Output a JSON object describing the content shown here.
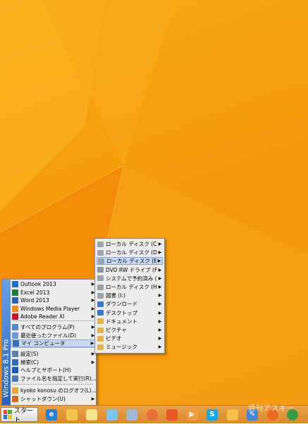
{
  "start_menu": {
    "banner": "Windows 8.1 Pro",
    "pinned": [
      {
        "label": "Outlook 2013",
        "icon": "outlook-icon",
        "color": "#1f6fc5",
        "has_arrow": true
      },
      {
        "label": "Excel 2013",
        "icon": "excel-icon",
        "color": "#1f7a3a",
        "has_arrow": true
      },
      {
        "label": "Word 2013",
        "icon": "word-icon",
        "color": "#2b5fb4",
        "has_arrow": true
      },
      {
        "label": "Windows Media Player",
        "icon": "media-player-icon",
        "color": "#f08a1c",
        "has_arrow": true
      },
      {
        "label": "Adobe Reader XI",
        "icon": "adobe-reader-icon",
        "color": "#c8102e",
        "has_arrow": true
      }
    ],
    "items": [
      {
        "label": "すべてのプログラム(P)",
        "icon": "programs-icon",
        "color": "#5a86c8",
        "has_arrow": true
      },
      {
        "label": "最近使ったファイル(D)",
        "icon": "recent-files-icon",
        "color": "#6a9bd6",
        "has_arrow": true
      },
      {
        "label": "マイ コンピュータ",
        "icon": "my-computer-icon",
        "color": "#3a6db0",
        "has_arrow": true,
        "selected": true
      }
    ],
    "settings": [
      {
        "label": "設定(S)",
        "icon": "settings-icon",
        "color": "#5d7fa8",
        "has_arrow": true
      },
      {
        "label": "検索(C)",
        "icon": "search-icon",
        "color": "#2f6bbd",
        "has_arrow": true
      },
      {
        "label": "ヘルプとサポート(H)",
        "icon": "help-icon",
        "color": "#1d58b8",
        "has_arrow": false
      },
      {
        "label": "ファイル名を指定して実行(R)...",
        "icon": "run-icon",
        "color": "#4a78b8",
        "has_arrow": false
      }
    ],
    "session": [
      {
        "label": "kyoko konosu のログオフ(L)...",
        "icon": "logoff-icon",
        "color": "#e8a73a",
        "has_arrow": false
      },
      {
        "label": "シャットダウン(U)",
        "icon": "shutdown-icon",
        "color": "#d66a1e",
        "has_arrow": true
      }
    ]
  },
  "sub_menu": {
    "items": [
      {
        "label": "ローカル ディスク (C:)",
        "icon": "drive-icon",
        "color": "#9aa4ae"
      },
      {
        "label": "ローカル ディスク (D:)",
        "icon": "drive-icon",
        "color": "#9aa4ae"
      },
      {
        "label": "ローカル ディスク (E:)",
        "icon": "drive-icon",
        "color": "#9aa4ae",
        "selected": true
      },
      {
        "label": "DVD RW ドライブ (F:)",
        "icon": "dvd-drive-icon",
        "color": "#8a96a2"
      },
      {
        "label": "システムで予約済み (G:)",
        "icon": "drive-icon",
        "color": "#9aa4ae"
      },
      {
        "label": "ローカル ディスク (H:)",
        "icon": "drive-icon",
        "color": "#9aa4ae"
      },
      {
        "label": "図書 (I:)",
        "icon": "drive-icon",
        "color": "#9aa4ae"
      },
      {
        "label": "ダウンロード",
        "icon": "downloads-folder-icon",
        "color": "#3b78c8"
      },
      {
        "label": "デスクトップ",
        "icon": "desktop-folder-icon",
        "color": "#3b78c8"
      },
      {
        "label": "ドキュメント",
        "icon": "documents-folder-icon",
        "color": "#e0b44a"
      },
      {
        "label": "ピクチャ",
        "icon": "pictures-folder-icon",
        "color": "#e0b44a"
      },
      {
        "label": "ビデオ",
        "icon": "videos-folder-icon",
        "color": "#e0b44a"
      },
      {
        "label": "ミュージック",
        "icon": "music-folder-icon",
        "color": "#e0b44a"
      }
    ]
  },
  "taskbar": {
    "start_label": "スタート",
    "apps": [
      {
        "name": "internet-explorer-icon",
        "glyph": "e",
        "color": "#2a7fd4"
      },
      {
        "name": "file-explorer-icon",
        "glyph": "",
        "color": "#f1c44e"
      },
      {
        "name": "sticky-notes-icon",
        "glyph": "",
        "color": "#f5e28a"
      },
      {
        "name": "notepad-icon",
        "glyph": "",
        "color": "#7fc4e8"
      },
      {
        "name": "calculator-icon",
        "glyph": "",
        "color": "#9fb7d0"
      },
      {
        "name": "paint-icon",
        "glyph": "",
        "color": "#e76f3c"
      },
      {
        "name": "media-center-icon",
        "glyph": "",
        "color": "#e85a2c"
      },
      {
        "name": "video-player-icon",
        "glyph": "▶",
        "color": "#f39a3a"
      },
      {
        "name": "skype-icon",
        "glyph": "S",
        "color": "#14a9e8"
      },
      {
        "name": "taskbar-app-icon",
        "glyph": "",
        "color": "#f4c04a"
      },
      {
        "name": "pen-icon",
        "glyph": "✎",
        "color": "#4a86d0"
      },
      {
        "name": "firefox-icon",
        "glyph": "",
        "color": "#ea6a1e"
      },
      {
        "name": "chrome-icon",
        "glyph": "",
        "color": "#3b9a45"
      }
    ]
  },
  "watermark": "週刊アスキー"
}
